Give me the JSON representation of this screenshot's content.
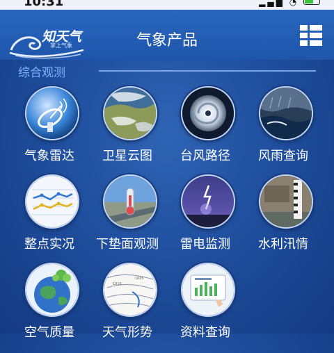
{
  "status": {
    "time": "10:31"
  },
  "app": {
    "logo_text": "知天气",
    "logo_sub": "掌上气象"
  },
  "header": {
    "title": "气象产品"
  },
  "section": {
    "title": "综合观测"
  },
  "tiles": [
    {
      "label": "气象雷达",
      "icon": "radar-icon"
    },
    {
      "label": "卫星云图",
      "icon": "satellite-icon"
    },
    {
      "label": "台风路径",
      "icon": "typhoon-icon"
    },
    {
      "label": "风雨查询",
      "icon": "storm-icon"
    },
    {
      "label": "整点实况",
      "icon": "chart-icon"
    },
    {
      "label": "下垫面观测",
      "icon": "thermometer-icon"
    },
    {
      "label": "雷电监测",
      "icon": "lightning-icon"
    },
    {
      "label": "水利汛情",
      "icon": "water-level-icon"
    },
    {
      "label": "空气质量",
      "icon": "earth-icon"
    },
    {
      "label": "天气形势",
      "icon": "weather-map-icon"
    },
    {
      "label": "资料查询",
      "icon": "data-query-icon"
    }
  ]
}
